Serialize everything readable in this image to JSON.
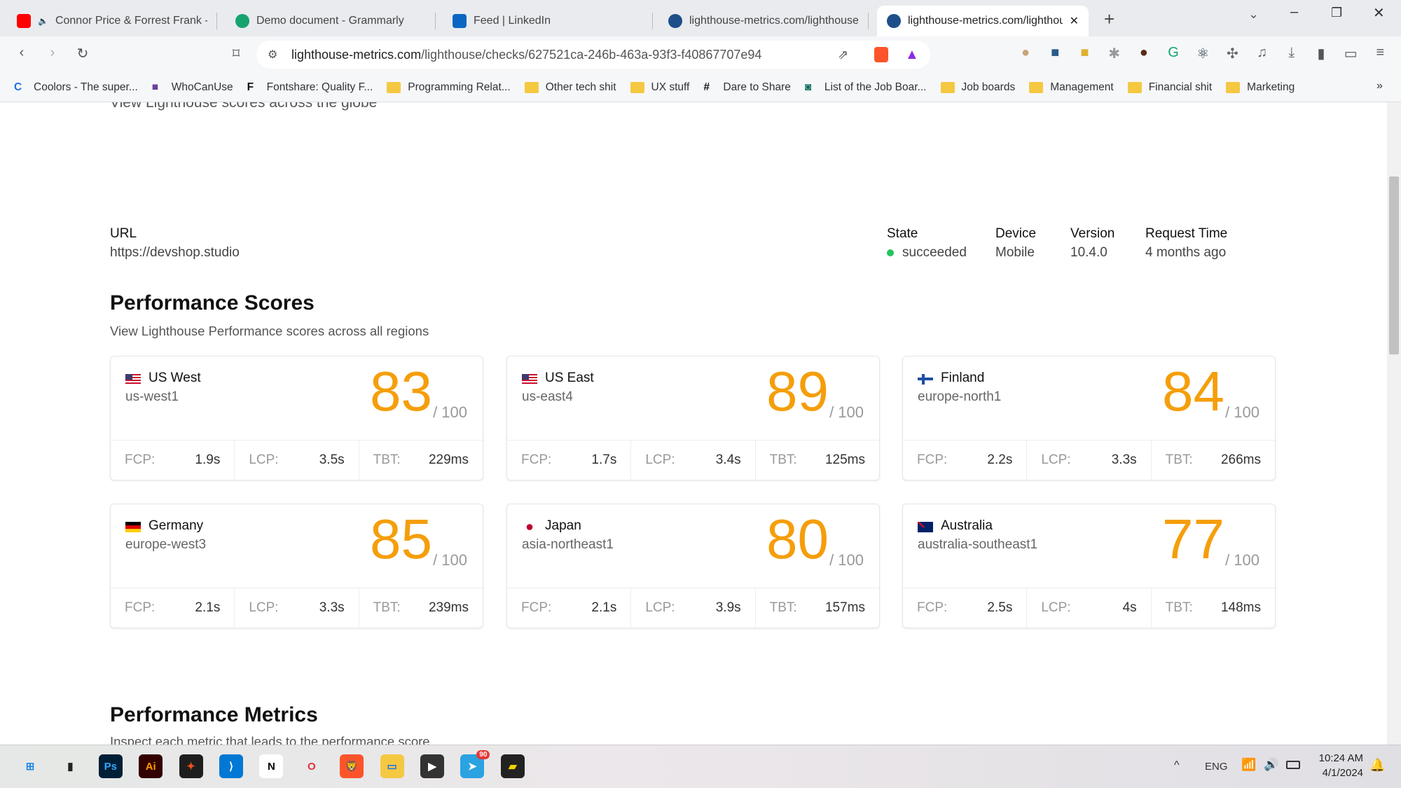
{
  "browser": {
    "tabs": [
      {
        "title": "Connor Price & Forrest Frank - U",
        "icon": "youtube-icon",
        "color": "#ff0000"
      },
      {
        "title": "Demo document - Grammarly",
        "icon": "grammarly-icon",
        "color": "#15a36e"
      },
      {
        "title": "Feed | LinkedIn",
        "icon": "linkedin-icon",
        "color": "#0a66c2"
      },
      {
        "title": "lighthouse-metrics.com/lighthouse/c",
        "icon": "lighthouse-icon",
        "color": "#1e4f8a"
      },
      {
        "title": "lighthouse-metrics.com/lighthou",
        "icon": "lighthouse-icon",
        "color": "#1e4f8a",
        "active": true
      }
    ],
    "url_domain": "lighthouse-metrics.com",
    "url_path": "/lighthouse/checks/627521ca-246b-463a-93f3-f40867707e94",
    "bookmarks": [
      "Coolors - The super...",
      "WhoCanUse",
      "Fontshare: Quality F...",
      "Programming Relat...",
      "Other tech shit",
      "UX stuff",
      "Dare to Share",
      "List of the Job Boar...",
      "Job boards",
      "Management",
      "Financial shit",
      "Marketing"
    ]
  },
  "page": {
    "globe_subtitle": "View Lighthouse scores across the globe",
    "url_label": "URL",
    "url_value": "https://devshop.studio",
    "state_label": "State",
    "state_value": "succeeded",
    "state_color": "#22c55e",
    "device_label": "Device",
    "device_value": "Mobile",
    "version_label": "Version",
    "version_value": "10.4.0",
    "request_label": "Request Time",
    "request_value": "4 months ago",
    "scores_title": "Performance Scores",
    "scores_subtitle": "View Lighthouse Performance scores across all regions",
    "score_color": "#f59e0b",
    "of_label": "/ 100",
    "metric_labels": {
      "fcp": "FCP:",
      "lcp": "LCP:",
      "tbt": "TBT:"
    },
    "regions": [
      {
        "name": "US West",
        "region": "us-west1",
        "flag": "us",
        "score": "83",
        "fcp": "1.9s",
        "lcp": "3.5s",
        "tbt": "229ms"
      },
      {
        "name": "US East",
        "region": "us-east4",
        "flag": "us",
        "score": "89",
        "fcp": "1.7s",
        "lcp": "3.4s",
        "tbt": "125ms"
      },
      {
        "name": "Finland",
        "region": "europe-north1",
        "flag": "fi",
        "score": "84",
        "fcp": "2.2s",
        "lcp": "3.3s",
        "tbt": "266ms"
      },
      {
        "name": "Germany",
        "region": "europe-west3",
        "flag": "de",
        "score": "85",
        "fcp": "2.1s",
        "lcp": "3.3s",
        "tbt": "239ms"
      },
      {
        "name": "Japan",
        "region": "asia-northeast1",
        "flag": "jp",
        "score": "80",
        "fcp": "2.1s",
        "lcp": "3.9s",
        "tbt": "157ms"
      },
      {
        "name": "Australia",
        "region": "australia-southeast1",
        "flag": "au",
        "score": "77",
        "fcp": "2.5s",
        "lcp": "4s",
        "tbt": "148ms"
      }
    ],
    "metrics_title": "Performance Metrics",
    "metrics_subtitle": "Inspect each metric that leads to the performance score"
  },
  "taskbar": {
    "lang": "ENG",
    "time": "10:24 AM",
    "date": "4/1/2024",
    "telegram_badge": "90"
  }
}
